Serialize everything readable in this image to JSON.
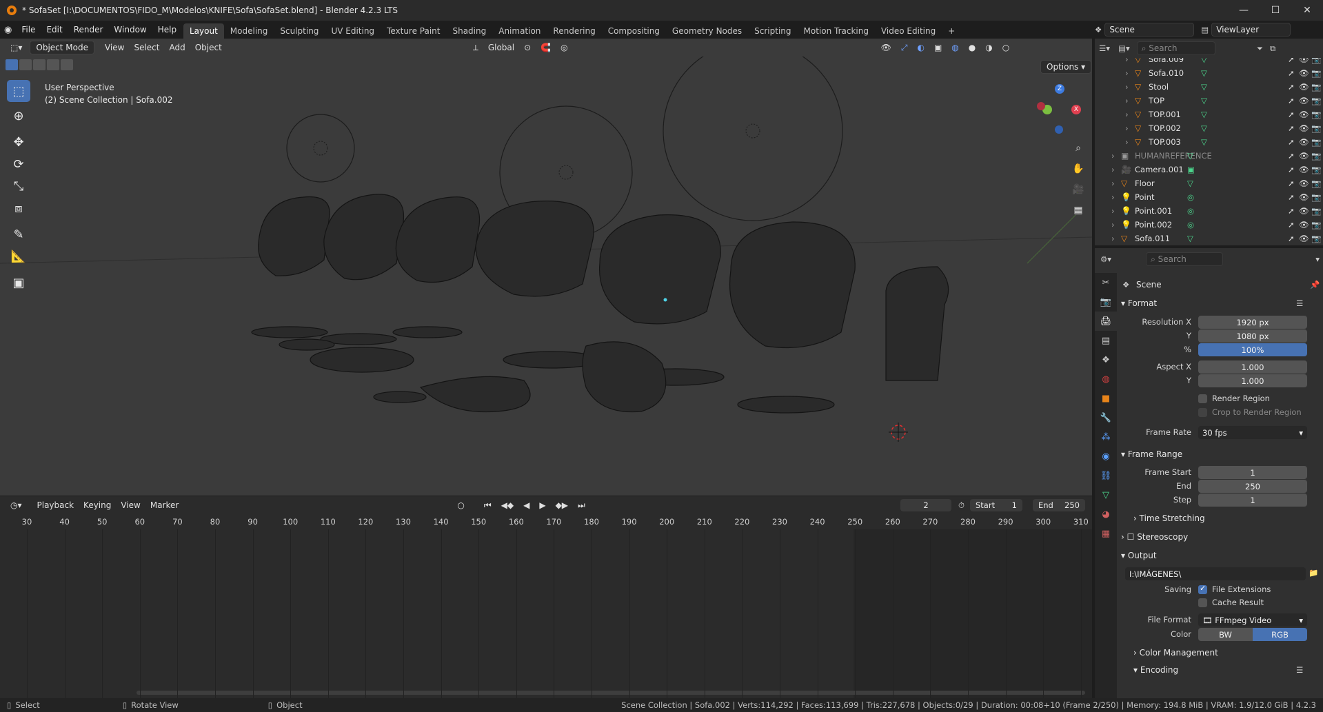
{
  "window": {
    "title": "* SofaSet [I:\\DOCUMENTOS\\FIDO_M\\Modelos\\KNIFE\\Sofa\\SofaSet.blend] - Blender 4.2.3 LTS",
    "minimize": "—",
    "maximize": "☐",
    "close": "✕"
  },
  "menu": [
    "File",
    "Edit",
    "Render",
    "Window",
    "Help"
  ],
  "workspaces": [
    "Layout",
    "Modeling",
    "Sculpting",
    "UV Editing",
    "Texture Paint",
    "Shading",
    "Animation",
    "Rendering",
    "Compositing",
    "Geometry Nodes",
    "Scripting",
    "Motion Tracking",
    "Video Editing"
  ],
  "active_workspace": "Layout",
  "scene_name": "Scene",
  "view_layer": "ViewLayer",
  "viewport": {
    "mode": "Object Mode",
    "menus": [
      "View",
      "Select",
      "Add",
      "Object"
    ],
    "orientation": "Global",
    "options_label": "Options",
    "overlay_line1": "User Perspective",
    "overlay_line2": "(2) Scene Collection | Sofa.002",
    "gizmo": {
      "z": "Z",
      "x": "X"
    }
  },
  "timeline": {
    "menus": [
      "Playback",
      "Keying",
      "View",
      "Marker"
    ],
    "current_frame": "2",
    "start_label": "Start",
    "start": "1",
    "end_label": "End",
    "end": "250",
    "ticks": [
      "30",
      "40",
      "50",
      "60",
      "70",
      "80",
      "90",
      "100",
      "110",
      "120",
      "130",
      "140",
      "150",
      "160",
      "170",
      "180",
      "190",
      "200",
      "210",
      "220",
      "230",
      "240",
      "250",
      "260",
      "270",
      "280",
      "290",
      "300",
      "310"
    ]
  },
  "outliner": {
    "search_placeholder": "Search",
    "rows": [
      {
        "name": "Sofa.009",
        "indent": 2,
        "type": "mesh"
      },
      {
        "name": "Sofa.010",
        "indent": 2,
        "type": "mesh"
      },
      {
        "name": "Stool",
        "indent": 2,
        "type": "mesh"
      },
      {
        "name": "TOP",
        "indent": 2,
        "type": "mesh"
      },
      {
        "name": "TOP.001",
        "indent": 2,
        "type": "mesh"
      },
      {
        "name": "TOP.002",
        "indent": 2,
        "type": "mesh"
      },
      {
        "name": "TOP.003",
        "indent": 2,
        "type": "mesh"
      },
      {
        "name": "HUMANREFERENCE",
        "indent": 1,
        "type": "collection",
        "badge": "7  7"
      },
      {
        "name": "Camera.001",
        "indent": 1,
        "type": "camera"
      },
      {
        "name": "Floor",
        "indent": 1,
        "type": "mesh"
      },
      {
        "name": "Point",
        "indent": 1,
        "type": "light"
      },
      {
        "name": "Point.001",
        "indent": 1,
        "type": "light"
      },
      {
        "name": "Point.002",
        "indent": 1,
        "type": "light"
      },
      {
        "name": "Sofa.011",
        "indent": 1,
        "type": "mesh"
      }
    ]
  },
  "properties": {
    "search_placeholder": "Search",
    "context": "Scene",
    "format_header": "Format",
    "resolution_x_label": "Resolution X",
    "resolution_x": "1920 px",
    "resolution_y_label": "Y",
    "resolution_y": "1080 px",
    "percent_label": "%",
    "percent": "100%",
    "aspect_x_label": "Aspect X",
    "aspect_x": "1.000",
    "aspect_y_label": "Y",
    "aspect_y": "1.000",
    "render_region": "Render Region",
    "crop_region": "Crop to Render Region",
    "frame_rate_label": "Frame Rate",
    "frame_rate": "30 fps",
    "frame_range_header": "Frame Range",
    "frame_start_label": "Frame Start",
    "frame_start": "1",
    "end_label": "End",
    "end": "250",
    "step_label": "Step",
    "step": "1",
    "time_stretching": "Time Stretching",
    "stereoscopy": "Stereoscopy",
    "output_header": "Output",
    "output_path": "I:\\IMÁGENES\\",
    "saving_label": "Saving",
    "file_extensions": "File Extensions",
    "cache_result": "Cache Result",
    "file_format_label": "File Format",
    "file_format": "FFmpeg Video",
    "color_label": "Color",
    "color_bw": "BW",
    "color_rgb": "RGB",
    "color_management": "Color Management",
    "encoding": "Encoding"
  },
  "statusbar": {
    "left1": "Select",
    "left2": "Rotate View",
    "left3": "Object",
    "info": "Scene Collection | Sofa.002 | Verts:114,292 | Faces:113,699 | Tris:227,678 | Objects:0/29 | Duration: 00:08+10 (Frame 2/250) | Memory: 194.8 MiB | VRAM: 1.9/12.0 GiB | 4.2.3"
  },
  "colors": {
    "accent": "#4772b3",
    "orange": "#e8841a",
    "green": "#4cd68d"
  }
}
